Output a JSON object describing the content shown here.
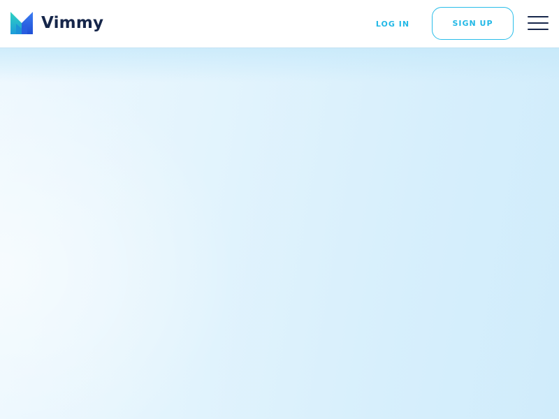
{
  "header": {
    "brand_name": "Vimmy",
    "login_label": "LOG IN",
    "signup_label": "SIGN UP",
    "logo_icon": "vimmy-logo-icon",
    "menu_icon": "hamburger-menu-icon"
  },
  "colors": {
    "accent": "#22b8e6",
    "brand_text": "#16264a",
    "hero_background": "#dcf1fc"
  }
}
